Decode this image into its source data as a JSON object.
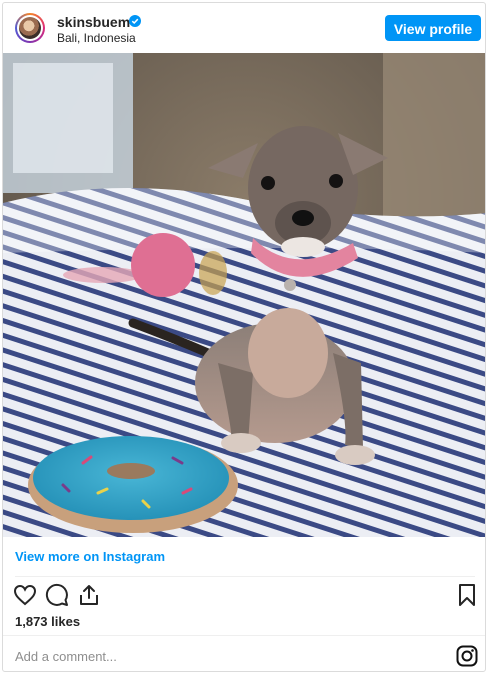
{
  "post": {
    "username": "skinsbuem",
    "location": "Bali, Indonesia",
    "view_profile_label": "View profile",
    "view_more_label": "View more on Instagram",
    "likes": "1,873 likes",
    "comment_placeholder": "Add a comment..."
  },
  "icons": {
    "verified": "verified-badge-icon",
    "like": "heart-icon",
    "comment": "comment-icon",
    "share": "share-icon",
    "save": "bookmark-icon",
    "instagram": "instagram-logo-icon"
  },
  "colors": {
    "accent": "#0095f6",
    "text": "#262626",
    "muted": "#8e8e8e",
    "border": "#dbdbdb"
  }
}
